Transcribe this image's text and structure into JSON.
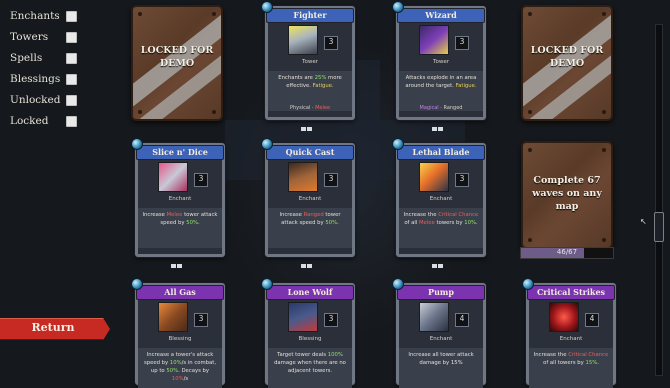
{
  "filters": [
    {
      "label": "Enchants",
      "checked": false
    },
    {
      "label": "Towers",
      "checked": false
    },
    {
      "label": "Spells",
      "checked": false
    },
    {
      "label": "Blessings",
      "checked": false
    },
    {
      "label": "Unlocked",
      "checked": false
    },
    {
      "label": "Locked",
      "checked": false
    }
  ],
  "return_label": "Return",
  "locked_cards": {
    "top_left": "LOCKED FOR DEMO",
    "top_right": "LOCKED FOR DEMO",
    "middle_right": "Complete 67 waves on any map",
    "progress_text": "46/67",
    "progress_fraction": 0.687
  },
  "cards": {
    "fighter": {
      "title": "Fighter",
      "cost": "3",
      "type": "Tower",
      "desc_a": "Enchants are ",
      "desc_hl": "25%",
      "desc_b": " more effective. ",
      "desc_hl2": "Fatigue.",
      "tag_a": "Physical",
      "tag_sep": " · ",
      "tag_b": "Melee"
    },
    "wizard": {
      "title": "Wizard",
      "cost": "3",
      "type": "Tower",
      "desc_a": "Attacks explode in an area around the target. ",
      "desc_hl2": "Fatigue.",
      "tag_a": "Magical",
      "tag_sep": " · ",
      "tag_b": "Ranged"
    },
    "slice": {
      "title": "Slice n' Dice",
      "cost": "3",
      "type": "Enchant",
      "desc_a": "Increase ",
      "desc_hl": "Melee",
      "desc_b": " tower attack speed by ",
      "desc_hl2": "50%",
      "desc_c": "."
    },
    "quickcast": {
      "title": "Quick Cast",
      "cost": "3",
      "type": "Enchant",
      "desc_a": "Increase ",
      "desc_hl": "Ranged",
      "desc_b": " tower attack speed by ",
      "desc_hl2": "50%",
      "desc_c": "."
    },
    "lethal": {
      "title": "Lethal Blade",
      "cost": "3",
      "type": "Enchant",
      "desc_a": "Increase the ",
      "desc_hl": "Critical Chance",
      "desc_b": " of all ",
      "desc_hl3": "Melee",
      "desc_c": " towers by ",
      "desc_hl2": "10%",
      "desc_d": "."
    },
    "allgas": {
      "title": "All Gas",
      "cost": "3",
      "type": "Blessing",
      "desc_a": "Increase a tower's attack speed by ",
      "desc_hl": "10%",
      "desc_b": "/s in combat, up to ",
      "desc_hl2": "50%",
      "desc_c": ". Decays by ",
      "desc_hl3": "10%",
      "desc_d": "/s"
    },
    "lonewolf": {
      "title": "Lone Wolf",
      "cost": "3",
      "type": "Blessing",
      "desc_a": "Target tower deals ",
      "desc_hl": "100%",
      "desc_b": " damage when there are no adjacent towers."
    },
    "pump": {
      "title": "Pump",
      "cost": "4",
      "type": "Enchant",
      "desc_a": "Increase all tower attack damage by 15%"
    },
    "critical": {
      "title": "Critical Strikes",
      "cost": "4",
      "type": "Enchant",
      "desc_a": "Increase the ",
      "desc_hl": "Critical Chance",
      "desc_b": " of all towers by ",
      "desc_hl2": "15%",
      "desc_c": "."
    }
  },
  "colors": {
    "blue_banner": "#3d63b8",
    "purple_banner": "#7c33b0",
    "return": "#c62a22",
    "locked_wood": "#6e4b35"
  }
}
